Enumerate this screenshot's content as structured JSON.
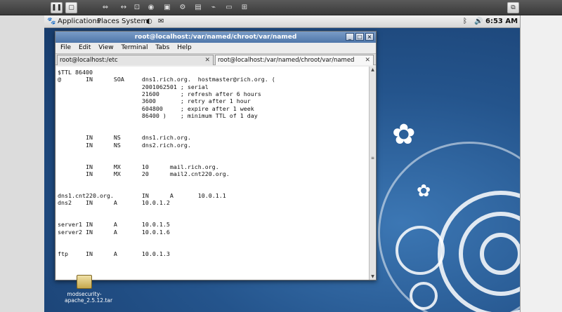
{
  "panel": {
    "applications": "Applications",
    "places": "Places",
    "system": "System",
    "clock": "6:53 AM"
  },
  "terminal": {
    "window_title": "root@localhost:/var/named/chroot/var/named",
    "menu": [
      "File",
      "Edit",
      "View",
      "Terminal",
      "Tabs",
      "Help"
    ],
    "tabs": [
      {
        "label": "root@localhost:/etc",
        "active": false
      },
      {
        "label": "root@localhost:/var/named/chroot/var/named",
        "active": true
      }
    ],
    "lines": [
      "$TTL 86400",
      "@       IN      SOA     dns1.rich.org.  hostmaster@rich.org. (",
      "                        2001062501 ; serial",
      "                        21600      ; refresh after 6 hours",
      "                        3600       ; retry after 1 hour",
      "                        604800     ; expire after 1 week",
      "                        86400 )    ; minimum TTL of 1 day",
      "",
      "",
      "        IN      NS      dns1.rich.org.",
      "        IN      NS      dns2.rich.org.",
      "",
      "",
      "        IN      MX      10      mail.rich.org.",
      "        IN      MX      20      mail2.cnt220.org.",
      "",
      "",
      "dns1.cnt220.org.        IN      A       10.0.1.1",
      "dns2    IN      A       10.0.1.2",
      "",
      "",
      "server1 IN      A       10.0.1.5",
      "server2 IN      A       10.0.1.6",
      "",
      "",
      "ftp     IN      A       10.0.1.3"
    ]
  },
  "desktop_icon": {
    "label": "modsecurity-apache_2.5.12.tar"
  },
  "colors": {
    "desktop": "#24548c",
    "titlebar": "#5a80b2"
  }
}
